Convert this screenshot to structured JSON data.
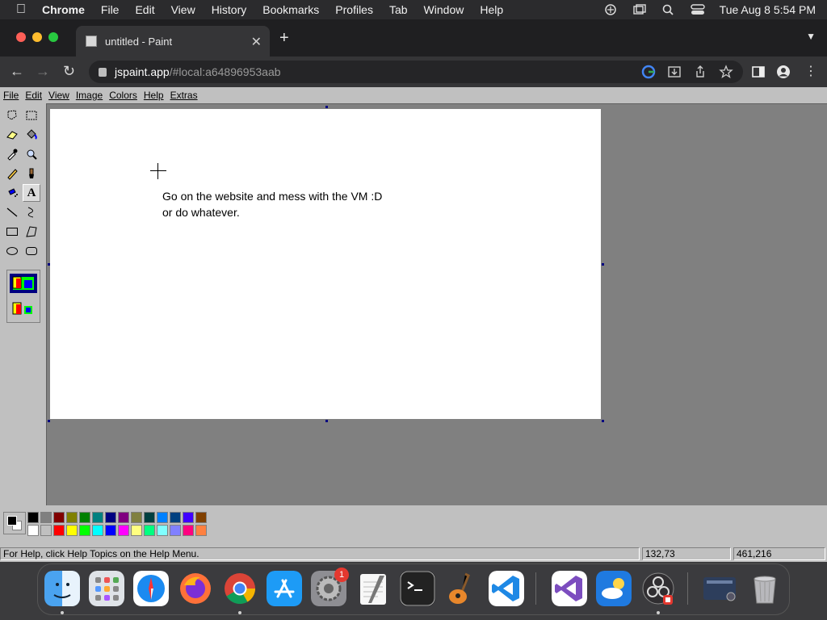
{
  "menubar": {
    "app": "Chrome",
    "items": [
      "File",
      "Edit",
      "View",
      "History",
      "Bookmarks",
      "Profiles",
      "Tab",
      "Window",
      "Help"
    ],
    "clock": "Tue Aug 8  5:54 PM",
    "icons": [
      "gpt-icon",
      "windows-icon",
      "search-icon",
      "control-center-icon"
    ]
  },
  "browser": {
    "tab_title": "untitled - Paint",
    "url_host": "jspaint.app",
    "url_rest": "/#local:a64896953aab"
  },
  "paint": {
    "menu": [
      "File",
      "Edit",
      "View",
      "Image",
      "Colors",
      "Help",
      "Extras"
    ],
    "canvas_text_line1": "Go on the website and mess with the VM :D",
    "canvas_text_line2": "or do whatever.",
    "status_help": "For Help, click Help Topics on the Help Menu.",
    "status_coords": "132,73",
    "status_size": "461,216",
    "palette_top": [
      "#000000",
      "#808080",
      "#800000",
      "#808000",
      "#008000",
      "#008080",
      "#000080",
      "#800080",
      "#808040",
      "#004040",
      "#0080ff",
      "#004080",
      "#4000ff",
      "#804000"
    ],
    "palette_bottom": [
      "#ffffff",
      "#c0c0c0",
      "#ff0000",
      "#ffff00",
      "#00ff00",
      "#00ffff",
      "#0000ff",
      "#ff00ff",
      "#ffff80",
      "#00ff80",
      "#80ffff",
      "#8080ff",
      "#ff0080",
      "#ff8040"
    ]
  },
  "dock": {
    "badge": "1"
  }
}
